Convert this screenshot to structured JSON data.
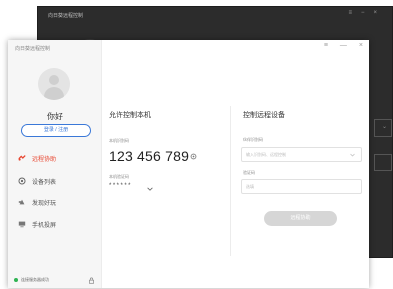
{
  "background_window": {
    "title": "向日葵远程控制"
  },
  "window": {
    "title": "向日葵远程控制",
    "controls": {
      "menu": "≡",
      "minimize": "—",
      "close": "×"
    }
  },
  "sidebar": {
    "greeting": "你好",
    "login_label": "登录 / 注册",
    "items": [
      {
        "label": "远程协助",
        "icon": "remote-assist-icon",
        "active": true
      },
      {
        "label": "设备列表",
        "icon": "device-list-icon",
        "active": false
      },
      {
        "label": "发现好玩",
        "icon": "discover-icon",
        "active": false
      },
      {
        "label": "手机投屏",
        "icon": "phone-cast-icon",
        "active": false
      }
    ],
    "status_text": "连接服务器成功"
  },
  "allow_control": {
    "heading": "允许控制本机",
    "id_label": "本机识别码",
    "id_value": "123 456 789",
    "code_label": "本机验证码",
    "code_value": "******"
  },
  "control_remote": {
    "heading": "控制远程设备",
    "partner_label": "伙伴识别码",
    "partner_placeholder": "输入识别码、远程控制",
    "code_label": "验证码",
    "code_placeholder": "选填",
    "connect_label": "远程协助"
  },
  "colors": {
    "accent_blue": "#3a78d8",
    "active_red": "#e8452f",
    "status_green": "#2eb352",
    "button_disabled": "#d6d6d6"
  }
}
